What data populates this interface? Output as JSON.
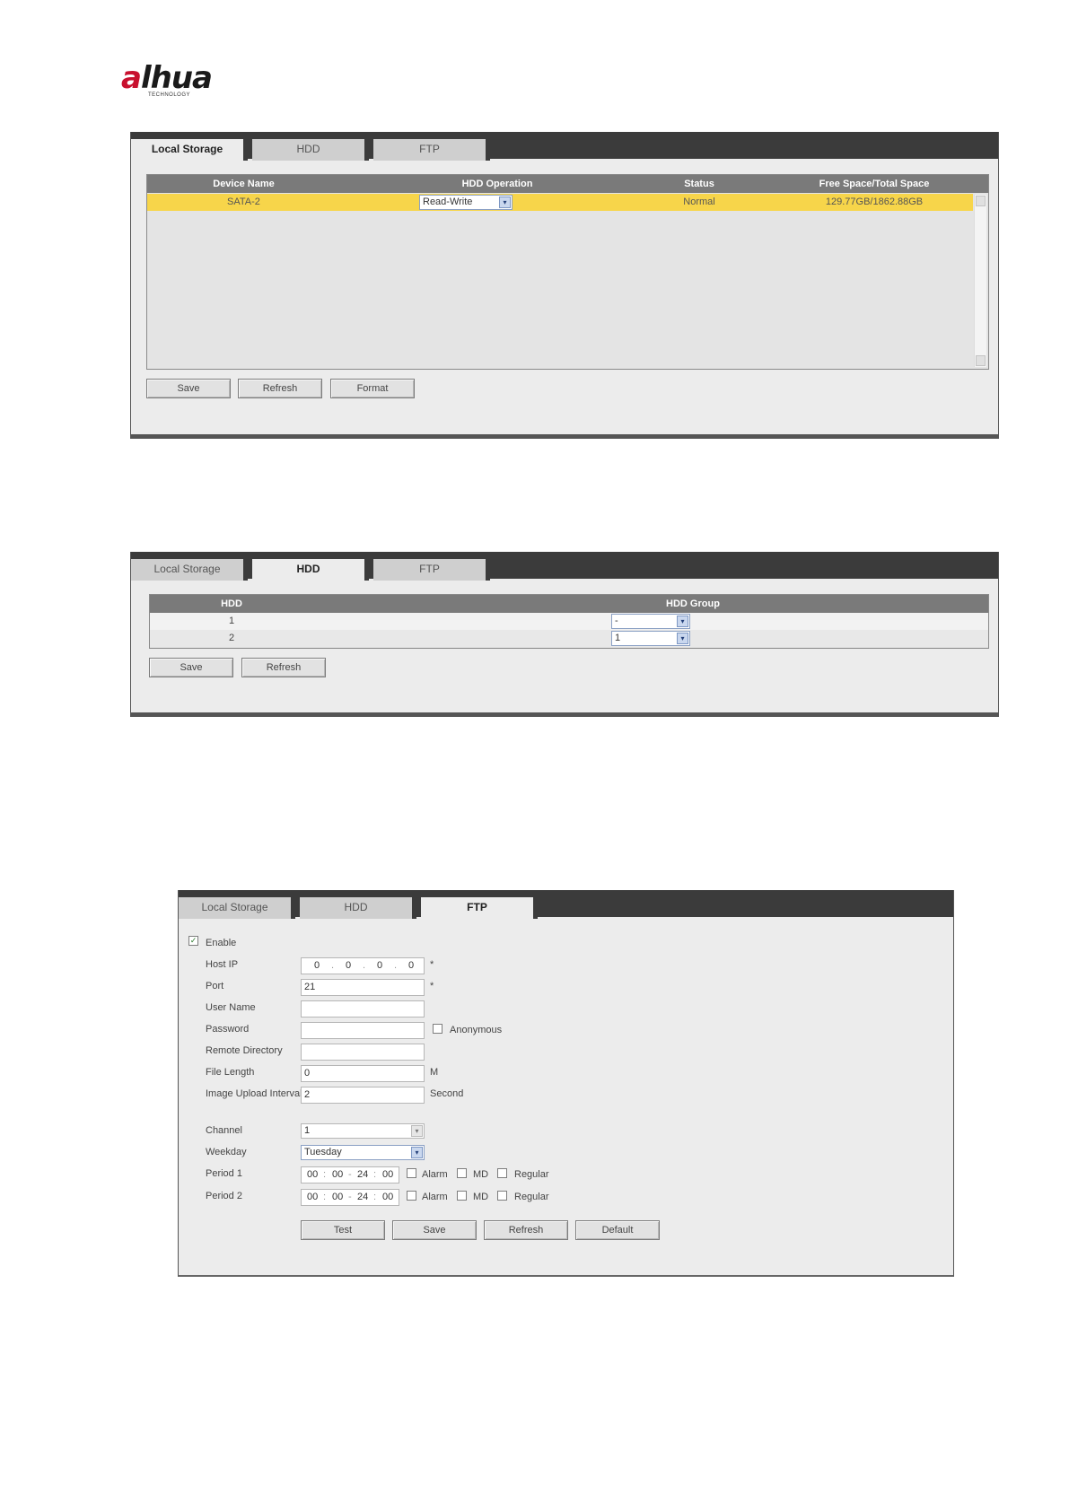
{
  "logo": {
    "brand_a": "a",
    "brand_rest": "lhua",
    "sub": "TECHNOLOGY"
  },
  "tabs": {
    "local_storage": "Local Storage",
    "hdd": "HDD",
    "ftp": "FTP"
  },
  "local_storage": {
    "headers": [
      "Device Name",
      "HDD Operation",
      "Status",
      "Free Space/Total Space"
    ],
    "rows": [
      {
        "device_name": "SATA-2",
        "hdd_operation": "Read-Write",
        "status": "Normal",
        "space": "129.77GB/1862.88GB"
      }
    ],
    "buttons": {
      "save": "Save",
      "refresh": "Refresh",
      "format": "Format"
    }
  },
  "hdd": {
    "headers": [
      "HDD",
      "HDD Group"
    ],
    "rows": [
      {
        "hdd": "1",
        "group": "-"
      },
      {
        "hdd": "2",
        "group": "1"
      }
    ],
    "buttons": {
      "save": "Save",
      "refresh": "Refresh"
    }
  },
  "ftp": {
    "enable_label": "Enable",
    "enable_checked": "✓",
    "host_ip_label": "Host IP",
    "host_ip": [
      "0",
      "0",
      "0",
      "0"
    ],
    "ip_dot": ".",
    "required_mark": "*",
    "port_label": "Port",
    "port": "21",
    "user_name_label": "User Name",
    "user_name": "",
    "password_label": "Password",
    "password": "",
    "anonymous_label": "Anonymous",
    "remote_dir_label": "Remote Directory",
    "remote_dir": "",
    "file_length_label": "File Length",
    "file_length": "0",
    "file_length_unit": "M",
    "upload_interval_label": "Image Upload Interval",
    "upload_interval": "2",
    "upload_interval_unit": "Second",
    "channel_label": "Channel",
    "channel": "1",
    "weekday_label": "Weekday",
    "weekday": "Tuesday",
    "period1_label": "Period 1",
    "period2_label": "Period 2",
    "period_fields": [
      "00",
      "00",
      "24",
      "00"
    ],
    "period_sep1": ":",
    "period_sep2": "-",
    "period_sep3": ":",
    "alarm_label": "Alarm",
    "md_label": "MD",
    "regular_label": "Regular",
    "buttons": {
      "test": "Test",
      "save": "Save",
      "refresh": "Refresh",
      "default": "Default"
    }
  },
  "icons": {
    "dropdown": "▾"
  }
}
